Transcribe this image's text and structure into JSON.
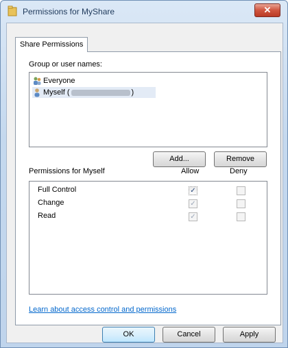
{
  "window": {
    "title": "Permissions for MyShare",
    "close_glyph": "✕"
  },
  "tab": {
    "label": "Share Permissions"
  },
  "group_label": "Group or user names:",
  "principals": [
    {
      "name": "Everyone",
      "icon": "users-icon"
    },
    {
      "name": "Myself (",
      "suffix": ")",
      "icon": "user-icon",
      "redacted": true
    }
  ],
  "buttons": {
    "add": "Add...",
    "remove": "Remove",
    "ok": "OK",
    "cancel": "Cancel",
    "apply": "Apply"
  },
  "permissions": {
    "heading": "Permissions for Myself",
    "allow_header": "Allow",
    "deny_header": "Deny",
    "rows": [
      {
        "name": "Full Control",
        "allow": true,
        "deny": false
      },
      {
        "name": "Change",
        "allow": true,
        "deny": false
      },
      {
        "name": "Read",
        "allow": true,
        "deny": false
      }
    ]
  },
  "help_link": "Learn about access control and permissions",
  "check_glyph": "✓"
}
